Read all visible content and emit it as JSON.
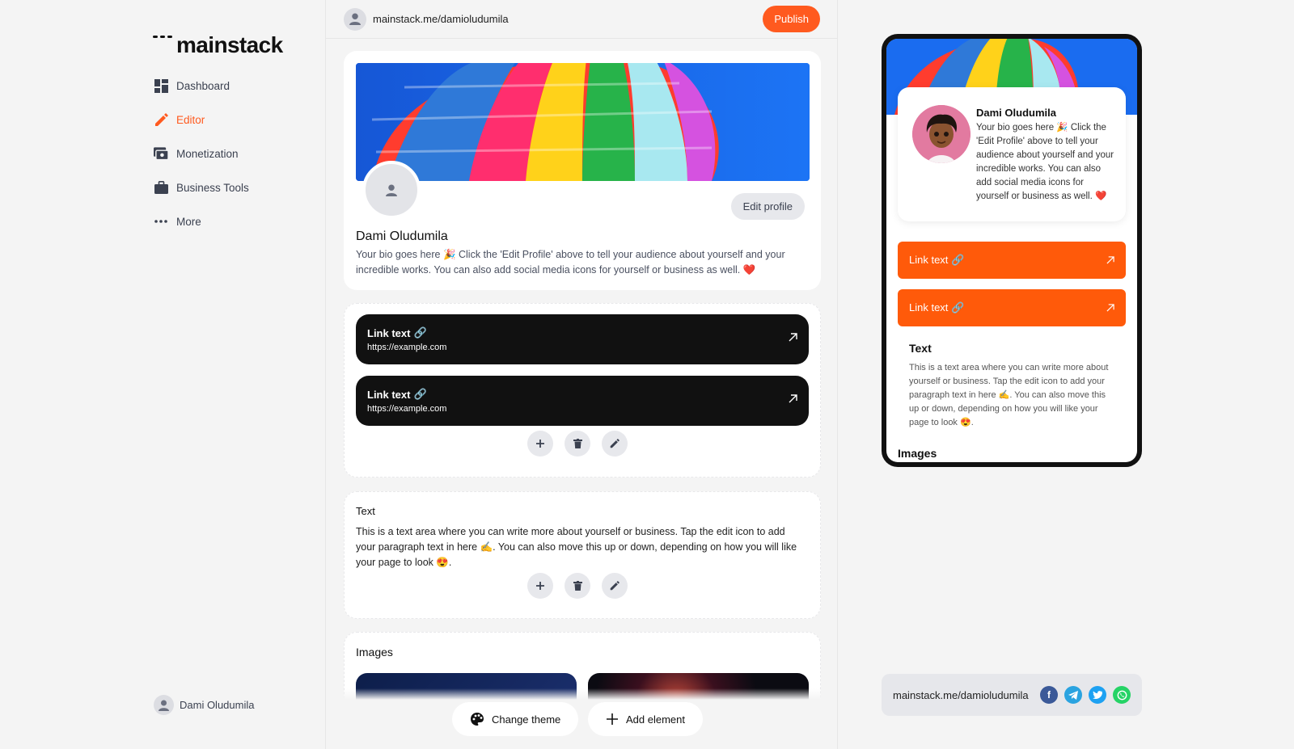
{
  "brand": {
    "name": "mainstack"
  },
  "sidebar": {
    "items": [
      {
        "label": "Dashboard",
        "icon": "dashboard-icon"
      },
      {
        "label": "Editor",
        "icon": "pencil-icon"
      },
      {
        "label": "Monetization",
        "icon": "money-icon"
      },
      {
        "label": "Business Tools",
        "icon": "briefcase-icon"
      },
      {
        "label": "More",
        "icon": "more-icon"
      }
    ],
    "active": "Editor",
    "user_name": "Dami Oludumila"
  },
  "topbar": {
    "url": "mainstack.me/damioludumila",
    "publish_label": "Publish"
  },
  "profile": {
    "name": "Dami Oludumila",
    "bio": "Your bio goes here 🎉 Click the 'Edit Profile' above to tell your audience about yourself and your incredible works. You can also add social media icons for yourself or business as well. ❤️",
    "edit_label": "Edit profile"
  },
  "links": [
    {
      "text": "Link text",
      "url": "https://example.com"
    },
    {
      "text": "Link text",
      "url": "https://example.com"
    }
  ],
  "text_block": {
    "heading": "Text",
    "body": "This is a text area where you can write more about yourself or business. Tap the edit icon to add your paragraph text in here ✍️. You can also move this up or down, depending on how you will like your page to look 😍."
  },
  "images_block": {
    "heading": "Images"
  },
  "actions": {
    "change_theme": "Change theme",
    "add_element": "Add element"
  },
  "preview": {
    "name": "Dami Oludumila",
    "bio": "Your bio goes here 🎉 Click the 'Edit Profile' above to tell your audience about yourself and your incredible works. You can also add social media icons for yourself or business as well. ❤️",
    "links": [
      "Link text 🔗",
      "Link text 🔗"
    ],
    "text_heading": "Text",
    "text_body": "This is a text area where you can write more about yourself or business. Tap the edit icon to add your paragraph text in here ✍️. You can also move this up or down, depending on how you will like your page to look 😍.",
    "images_heading": "Images"
  },
  "share": {
    "url": "mainstack.me/damioludumila",
    "socials": [
      "facebook-icon",
      "telegram-icon",
      "twitter-icon",
      "whatsapp-icon"
    ]
  },
  "colors": {
    "accent": "#ff5a1f",
    "dark": "#111111",
    "cover_blue": "#1a6cf0"
  }
}
